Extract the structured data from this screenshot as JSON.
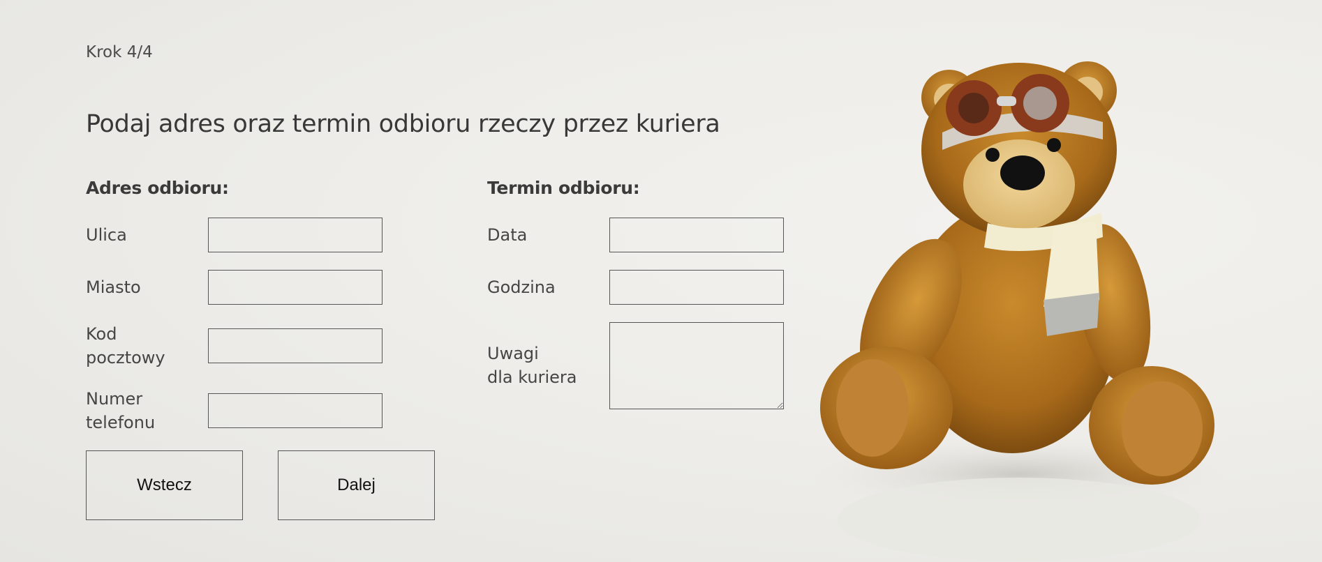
{
  "step": "Krok 4/4",
  "title": "Podaj adres oraz termin odbioru rzeczy przez kuriera",
  "address": {
    "heading": "Adres odbioru:",
    "street_label": "Ulica",
    "city_label": "Miasto",
    "postal_label_line1": "Kod",
    "postal_label_line2": "pocztowy",
    "phone_label_line1": "Numer",
    "phone_label_line2": "telefonu",
    "street_value": "",
    "city_value": "",
    "postal_value": "",
    "phone_value": ""
  },
  "pickup": {
    "heading": "Termin odbioru:",
    "date_label": "Data",
    "time_label": "Godzina",
    "notes_label_line1": "Uwagi",
    "notes_label_line2": "dla kuriera",
    "date_value": "",
    "time_value": "",
    "notes_value": ""
  },
  "buttons": {
    "back_label": "Wstecz",
    "next_label": "Dalej"
  },
  "image": {
    "subject": "teddy-bear-with-aviator-goggles-and-scarf"
  }
}
